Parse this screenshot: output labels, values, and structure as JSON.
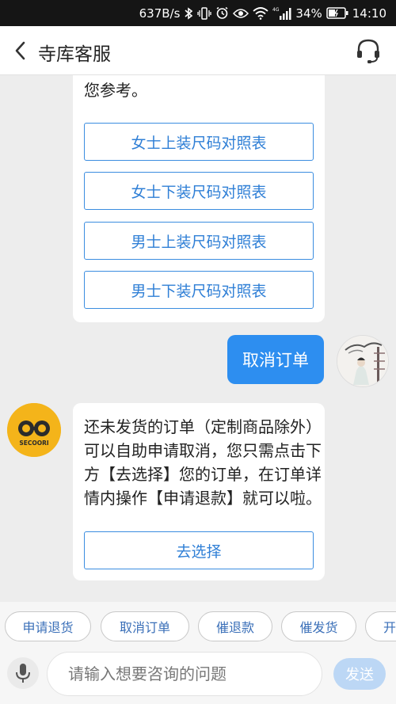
{
  "status_bar": {
    "speed": "637B/s",
    "network": "4G",
    "battery": "34%",
    "time": "14:10"
  },
  "header": {
    "title": "寺库客服"
  },
  "messages": {
    "size_card": {
      "intro": "下面有详细尺码对照表和推荐供您参考。",
      "options": [
        "女士上装尺码对照表",
        "女士下装尺码对照表",
        "男士上装尺码对照表",
        "男士下装尺码对照表"
      ]
    },
    "user_message": "取消订单",
    "bot_reply": {
      "text": "还未发货的订单（定制商品除外）可以自助申请取消，您只需点击下方【去选择】您的订单，在订单详情内操作【申请退款】就可以啦。",
      "button": "去选择"
    },
    "bot_avatar_label": "SECOORI"
  },
  "quick_replies": [
    "申请退货",
    "取消订单",
    "催退款",
    "催发货",
    "开"
  ],
  "input": {
    "placeholder": "请输入想要咨询的问题",
    "value": "",
    "send_label": "发送"
  },
  "colors": {
    "accent": "#2d8ef0",
    "status_bar": "#151515",
    "chip_text": "#3a6fb8",
    "send_disabled": "#bcd7f5"
  }
}
